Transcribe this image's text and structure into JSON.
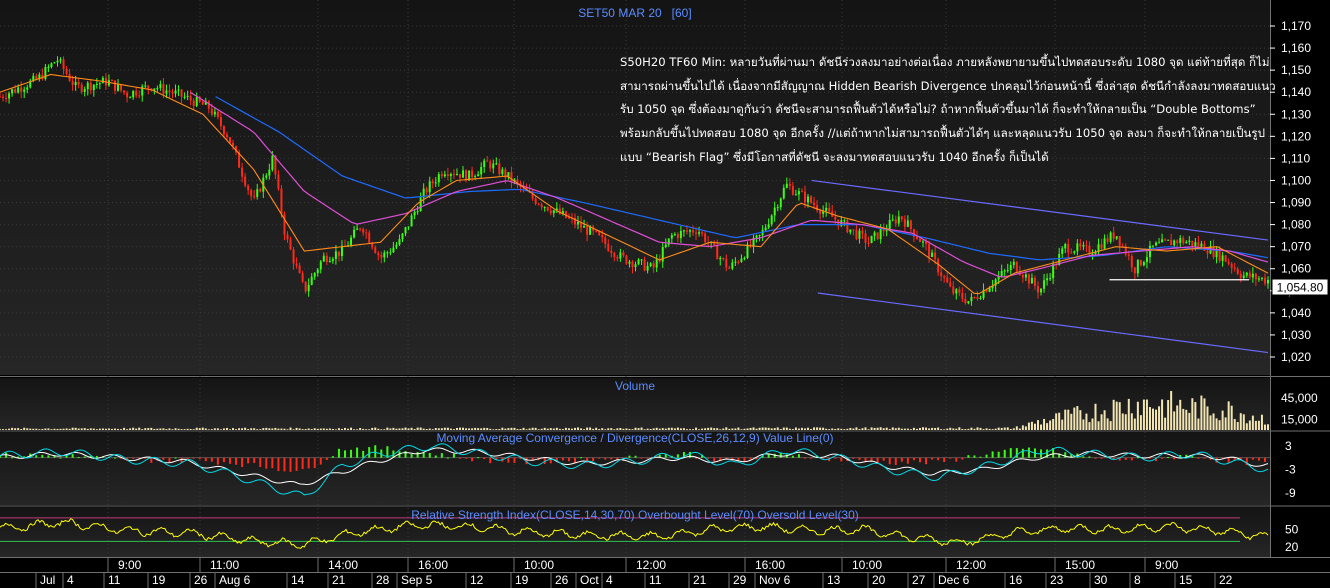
{
  "header": {
    "title": "SET50 MAR 20   [60]"
  },
  "annotation": {
    "lines": [
      "S50H20 TF60 Min: หลายวันที่ผ่านมา ดัชนีร่วงลงมาอย่างต่อเนื่อง ภายหลังพยายามขึ้นไปทดสอบระดับ 1080 จุด แต่ท้ายที่สุด ก็ไม่",
      "สามารถผ่านขึ้นไปได้ เนื่องจากมีสัญญาณ Hidden Bearish Divergence ปกคลุมไว้ก่อนหน้านี้ ซึ่งล่าสุด ดัชนีกำลังลงมาทดสอบแนว",
      "รับ 1050 จุด ซึ่งต้องมาดูกันว่า ดัชนีจะสามารถฟื้นตัวได้หรือไม่? ถ้าหากฟื้นตัวขึ้นมาได้ ก็จะทำให้กลายเป็น “Double Bottoms”",
      "พร้อมกลับขึ้นไปทดสอบ 1080 จุด อีกครั้ง //แต่ถ้าหากไม่สามารถฟื้นตัวได้ๆ และหลุดแนวรับ 1050 จุด ลงมา ก็จะทำให้กลายเป็นรูป",
      "แบบ “Bearish Flag” ซึ่งมีโอกาสที่ดัชนี จะลงมาทดสอบแนวรับ 1040 อีกครั้ง ก็เป็นได้"
    ]
  },
  "panels": {
    "price": {
      "yticks": [
        "1,170",
        "1,160",
        "1,150",
        "1,140",
        "1,130",
        "1,120",
        "1,110",
        "1,100",
        "1,090",
        "1,080",
        "1,070",
        "1,060",
        "1,050",
        "1,040",
        "1,030",
        "1,020"
      ],
      "last_price": "1,054.80"
    },
    "volume": {
      "title": "Volume",
      "yticks": [
        "45,000",
        "15,000"
      ]
    },
    "macd": {
      "title": "Moving Average Convergence / Divergence(CLOSE,26,12,9) Value Line(0)",
      "yticks": [
        "3",
        "-3",
        "-9"
      ]
    },
    "rsi": {
      "title": "Relative Strength Index(CLOSE,14,30,70) Overbought Level(70) Oversold Level(30)",
      "yticks": [
        "50",
        "20"
      ]
    }
  },
  "time_axis": {
    "top": [
      "9:00",
      "11:00",
      "14:00",
      "16:00",
      "10:00",
      "12:00",
      "16:00",
      "10:00",
      "12:00",
      "15:00",
      "9:00"
    ],
    "bottom": [
      "Jul",
      "4",
      "11",
      "19",
      "26",
      "Aug 6",
      "14",
      "21",
      "28",
      "Sep 5",
      "12",
      "19",
      "26",
      "Oct",
      "4",
      "11",
      "21",
      "29",
      "Nov 6",
      "13",
      "20",
      "27",
      "Dec 6",
      "16",
      "23",
      "30",
      "8",
      "15",
      "22"
    ]
  },
  "chart_data": [
    {
      "type": "candlestick",
      "title": "SET50 MAR 20   [60]",
      "ylim": [
        1017,
        1176
      ],
      "last_value": 1054.8,
      "overlays": [
        "moving average (orange)",
        "moving average (magenta)",
        "moving average (blue)",
        "downtrend channel (blue lines)",
        "support line 1055"
      ],
      "close_path": [
        [
          0,
          1138
        ],
        [
          0.03,
          1146
        ],
        [
          0.045,
          1155
        ],
        [
          0.06,
          1142
        ],
        [
          0.085,
          1145
        ],
        [
          0.1,
          1139
        ],
        [
          0.12,
          1143
        ],
        [
          0.14,
          1139
        ],
        [
          0.165,
          1133
        ],
        [
          0.18,
          1120
        ],
        [
          0.2,
          1090
        ],
        [
          0.215,
          1110
        ],
        [
          0.225,
          1075
        ],
        [
          0.24,
          1050
        ],
        [
          0.255,
          1065
        ],
        [
          0.27,
          1068
        ],
        [
          0.285,
          1080
        ],
        [
          0.3,
          1065
        ],
        [
          0.315,
          1072
        ],
        [
          0.335,
          1095
        ],
        [
          0.35,
          1105
        ],
        [
          0.37,
          1102
        ],
        [
          0.385,
          1108
        ],
        [
          0.4,
          1102
        ],
        [
          0.42,
          1092
        ],
        [
          0.45,
          1082
        ],
        [
          0.47,
          1075
        ],
        [
          0.49,
          1065
        ],
        [
          0.515,
          1060
        ],
        [
          0.53,
          1075
        ],
        [
          0.55,
          1078
        ],
        [
          0.575,
          1060
        ],
        [
          0.6,
          1075
        ],
        [
          0.62,
          1098
        ],
        [
          0.64,
          1090
        ],
        [
          0.66,
          1082
        ],
        [
          0.685,
          1072
        ],
        [
          0.71,
          1084
        ],
        [
          0.73,
          1070
        ],
        [
          0.75,
          1050
        ],
        [
          0.765,
          1045
        ],
        [
          0.785,
          1055
        ],
        [
          0.8,
          1062
        ],
        [
          0.82,
          1050
        ],
        [
          0.84,
          1070
        ],
        [
          0.86,
          1068
        ],
        [
          0.88,
          1076
        ],
        [
          0.895,
          1060
        ],
        [
          0.91,
          1070
        ],
        [
          0.93,
          1073
        ],
        [
          0.95,
          1070
        ],
        [
          0.965,
          1065
        ],
        [
          0.98,
          1057
        ],
        [
          1,
          1054.8
        ]
      ],
      "ma_orange": [
        [
          0,
          1140
        ],
        [
          0.04,
          1148
        ],
        [
          0.08,
          1145
        ],
        [
          0.12,
          1141
        ],
        [
          0.16,
          1130
        ],
        [
          0.2,
          1105
        ],
        [
          0.24,
          1068
        ],
        [
          0.27,
          1070
        ],
        [
          0.3,
          1072
        ],
        [
          0.33,
          1090
        ],
        [
          0.36,
          1100
        ],
        [
          0.4,
          1102
        ],
        [
          0.44,
          1086
        ],
        [
          0.48,
          1075
        ],
        [
          0.52,
          1064
        ],
        [
          0.56,
          1072
        ],
        [
          0.6,
          1070
        ],
        [
          0.63,
          1090
        ],
        [
          0.66,
          1084
        ],
        [
          0.7,
          1078
        ],
        [
          0.74,
          1062
        ],
        [
          0.77,
          1048
        ],
        [
          0.8,
          1058
        ],
        [
          0.84,
          1064
        ],
        [
          0.88,
          1070
        ],
        [
          0.92,
          1068
        ],
        [
          0.96,
          1070
        ],
        [
          1,
          1058
        ]
      ],
      "ma_magenta": [
        [
          0.15,
          1140
        ],
        [
          0.2,
          1122
        ],
        [
          0.24,
          1095
        ],
        [
          0.28,
          1080
        ],
        [
          0.32,
          1085
        ],
        [
          0.36,
          1095
        ],
        [
          0.4,
          1100
        ],
        [
          0.44,
          1092
        ],
        [
          0.48,
          1082
        ],
        [
          0.52,
          1072
        ],
        [
          0.56,
          1070
        ],
        [
          0.6,
          1074
        ],
        [
          0.64,
          1082
        ],
        [
          0.68,
          1080
        ],
        [
          0.72,
          1076
        ],
        [
          0.76,
          1063
        ],
        [
          0.79,
          1056
        ],
        [
          0.82,
          1060
        ],
        [
          0.86,
          1066
        ],
        [
          0.9,
          1068
        ],
        [
          0.94,
          1070
        ],
        [
          0.97,
          1068
        ],
        [
          1,
          1063
        ]
      ],
      "ma_blue": [
        [
          0.17,
          1138
        ],
        [
          0.22,
          1122
        ],
        [
          0.27,
          1102
        ],
        [
          0.32,
          1092
        ],
        [
          0.37,
          1095
        ],
        [
          0.41,
          1096
        ],
        [
          0.46,
          1090
        ],
        [
          0.52,
          1082
        ],
        [
          0.58,
          1074
        ],
        [
          0.63,
          1080
        ],
        [
          0.68,
          1080
        ],
        [
          0.73,
          1074
        ],
        [
          0.78,
          1067
        ],
        [
          0.82,
          1064
        ],
        [
          0.87,
          1066
        ],
        [
          0.92,
          1070
        ],
        [
          0.97,
          1068
        ],
        [
          1,
          1065
        ]
      ],
      "trendline_upper": [
        [
          0.64,
          1100
        ],
        [
          1,
          1073
        ]
      ],
      "trendline_lower": [
        [
          0.645,
          1049
        ],
        [
          1,
          1022
        ]
      ],
      "support_line": [
        [
          0.875,
          1055
        ],
        [
          0.985,
          1055
        ]
      ]
    },
    {
      "type": "bar",
      "title": "Volume",
      "ylim": [
        0,
        70000
      ],
      "profile": [
        [
          0,
          2000
        ],
        [
          0.8,
          2500
        ],
        [
          0.82,
          12000
        ],
        [
          0.86,
          25000
        ],
        [
          0.9,
          38000
        ],
        [
          0.94,
          32000
        ],
        [
          0.97,
          28000
        ],
        [
          1,
          15000
        ]
      ]
    },
    {
      "type": "line",
      "title": "Moving Average Convergence / Divergence(CLOSE,26,12,9) Value Line(0)",
      "ylim": [
        -12,
        6
      ],
      "series": [
        {
          "name": "MACD",
          "values": [
            [
              0,
              0.5
            ],
            [
              0.05,
              1.5
            ],
            [
              0.1,
              -0.5
            ],
            [
              0.15,
              -1.5
            ],
            [
              0.18,
              -4
            ],
            [
              0.21,
              -7
            ],
            [
              0.24,
              -10
            ],
            [
              0.27,
              -2
            ],
            [
              0.3,
              1
            ],
            [
              0.34,
              3
            ],
            [
              0.38,
              1
            ],
            [
              0.42,
              -1
            ],
            [
              0.46,
              -2
            ],
            [
              0.5,
              -1
            ],
            [
              0.54,
              1
            ],
            [
              0.58,
              -2
            ],
            [
              0.62,
              2
            ],
            [
              0.66,
              0
            ],
            [
              0.7,
              -3
            ],
            [
              0.74,
              -5
            ],
            [
              0.78,
              -2
            ],
            [
              0.82,
              2
            ],
            [
              0.86,
              1
            ],
            [
              0.9,
              0
            ],
            [
              0.94,
              1
            ],
            [
              0.97,
              -1
            ],
            [
              1,
              -3
            ]
          ]
        },
        {
          "name": "Signal",
          "values": [
            [
              0,
              0
            ],
            [
              0.05,
              1
            ],
            [
              0.1,
              0
            ],
            [
              0.15,
              -1
            ],
            [
              0.18,
              -3
            ],
            [
              0.21,
              -5
            ],
            [
              0.24,
              -7
            ],
            [
              0.27,
              -4
            ],
            [
              0.3,
              -1
            ],
            [
              0.34,
              2
            ],
            [
              0.38,
              1.5
            ],
            [
              0.42,
              0
            ],
            [
              0.46,
              -1.5
            ],
            [
              0.5,
              -1
            ],
            [
              0.54,
              0
            ],
            [
              0.58,
              -1
            ],
            [
              0.62,
              1
            ],
            [
              0.66,
              0.5
            ],
            [
              0.7,
              -2
            ],
            [
              0.74,
              -4
            ],
            [
              0.78,
              -3
            ],
            [
              0.82,
              0
            ],
            [
              0.86,
              1
            ],
            [
              0.9,
              0.5
            ],
            [
              0.94,
              0.5
            ],
            [
              0.97,
              0
            ],
            [
              1,
              -2
            ]
          ]
        }
      ]
    },
    {
      "type": "line",
      "title": "Relative Strength Index(CLOSE,14,30,70) Overbought Level(70) Oversold Level(30)",
      "ylim": [
        5,
        85
      ],
      "levels": [
        70,
        30
      ],
      "profile": [
        [
          0,
          52
        ],
        [
          0.05,
          62
        ],
        [
          0.1,
          48
        ],
        [
          0.15,
          44
        ],
        [
          0.2,
          30
        ],
        [
          0.24,
          25
        ],
        [
          0.28,
          45
        ],
        [
          0.33,
          58
        ],
        [
          0.37,
          55
        ],
        [
          0.42,
          45
        ],
        [
          0.47,
          40
        ],
        [
          0.52,
          38
        ],
        [
          0.56,
          50
        ],
        [
          0.6,
          55
        ],
        [
          0.64,
          48
        ],
        [
          0.68,
          50
        ],
        [
          0.72,
          36
        ],
        [
          0.76,
          28
        ],
        [
          0.8,
          45
        ],
        [
          0.84,
          52
        ],
        [
          0.88,
          50
        ],
        [
          0.92,
          55
        ],
        [
          0.96,
          48
        ],
        [
          1,
          38
        ]
      ]
    }
  ]
}
